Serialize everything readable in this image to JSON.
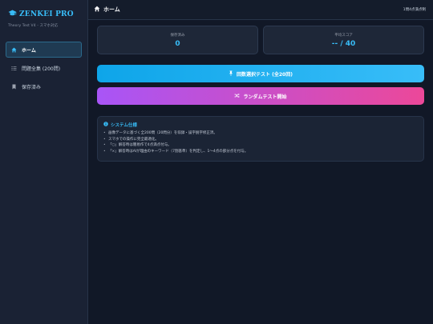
{
  "sidebar": {
    "brand_title": "ZENKEI PRO",
    "brand_subtitle": "Theory Test V4 - スマホ対応",
    "items": [
      {
        "label": "ホーム",
        "icon": "home-icon",
        "active": true
      },
      {
        "label": "問題全集 (200問)",
        "icon": "list-icon",
        "active": false
      },
      {
        "label": "保存済み",
        "icon": "bookmark-icon",
        "active": false
      }
    ]
  },
  "topbar": {
    "title": "ホーム",
    "right_text": "1問4点満点制"
  },
  "stats": [
    {
      "label": "保存済み",
      "value": "0"
    },
    {
      "label": "平均スコア",
      "value": "-- / 40"
    }
  ],
  "buttons": {
    "first_test": "回数選択テスト (全20回)",
    "random_test": "ランダムテスト開始"
  },
  "info": {
    "title": "システム仕様",
    "items": [
      "画像データに基づく全200問（20問分）を収録・誤字脱字修正済。",
      "スマホでの操作に完全最適化。",
      "「○」解答時は簡易作で4点満点付与。",
      "「×」解答時はAIが理由のキーワード（7割基準）を判定し、1〜4点の部分点を付与。"
    ]
  },
  "colors": {
    "accent": "#38bdf8",
    "background": "#111827",
    "sidebar": "#1a2234",
    "gradient_blue": [
      "#0ea5e9",
      "#38bdf8"
    ],
    "gradient_pink": [
      "#a855f7",
      "#ec4899"
    ]
  }
}
